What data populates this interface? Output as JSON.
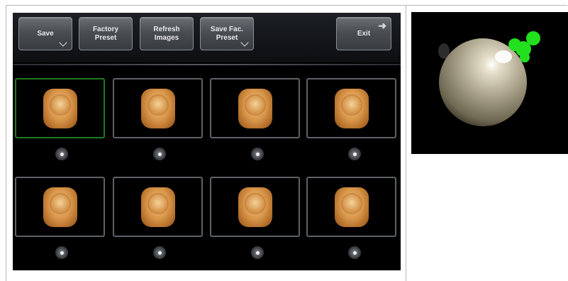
{
  "toolbar": {
    "save_label": "Save",
    "factory_preset_label": "Factory\nPreset",
    "refresh_images_label": "Refresh\nImages",
    "save_fac_preset_label": "Save Fac.\nPreset",
    "exit_label": "Exit"
  },
  "thumbnails": {
    "rows": 2,
    "columns": 4,
    "selected_index": 0
  },
  "colors": {
    "panel_background": "#000000",
    "selection_border": "#1f7a1c",
    "probe_marker": "#22e01e",
    "probe_ball": "#b0a890"
  }
}
